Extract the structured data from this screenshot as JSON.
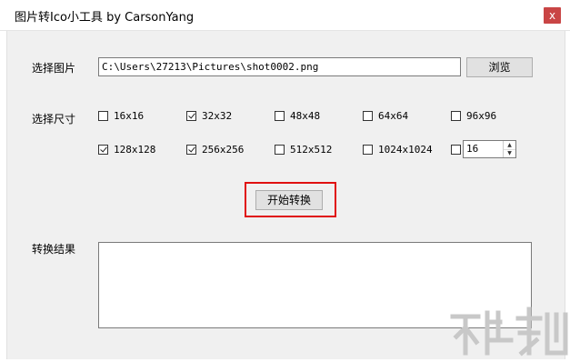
{
  "window": {
    "title": "图片转Ico小工具 by CarsonYang",
    "close_glyph": "x"
  },
  "select_image": {
    "label": "选择图片",
    "path_value": "C:\\Users\\27213\\Pictures\\shot0002.png",
    "browse_label": "浏览"
  },
  "sizes": {
    "label": "选择尺寸",
    "options": [
      {
        "label": "16x16",
        "checked": false
      },
      {
        "label": "32x32",
        "checked": true
      },
      {
        "label": "48x48",
        "checked": false
      },
      {
        "label": "64x64",
        "checked": false
      },
      {
        "label": "96x96",
        "checked": false
      },
      {
        "label": "128x128",
        "checked": true
      },
      {
        "label": "256x256",
        "checked": true
      },
      {
        "label": "512x512",
        "checked": false
      },
      {
        "label": "1024x1024",
        "checked": false
      }
    ],
    "custom": {
      "checked": false,
      "value": "16"
    }
  },
  "start_label": "开始转换",
  "result": {
    "label": "转换结果"
  },
  "colors": {
    "highlight": "#e01010",
    "close_bg": "#c94545",
    "client_bg": "#f0f0f0"
  }
}
